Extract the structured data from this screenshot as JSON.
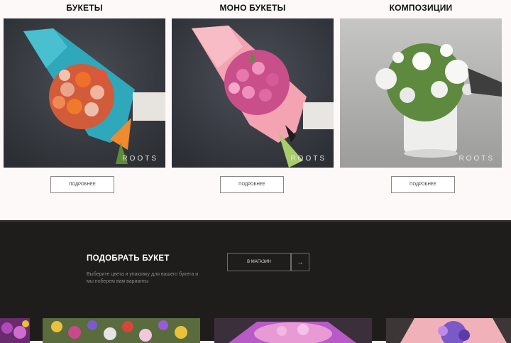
{
  "categories": [
    {
      "title": "БУКЕТЫ",
      "button_label": "ПОДРОБНЕЕ",
      "watermark": "ROOTS"
    },
    {
      "title": "МОНО БУКЕТЫ",
      "button_label": "ПОДРОБНЕЕ",
      "watermark": "ROOTS"
    },
    {
      "title": "КОМПОЗИЦИИ",
      "button_label": "ПОДРОБНЕЕ",
      "watermark": "ROOTS"
    }
  ],
  "picker": {
    "title": "ПОДОБРАТЬ БУКЕТ",
    "description": "Выберите цвета и упаковку для вашего букета и мы поберем вам варианты",
    "shop_button": "В МАГАЗИН",
    "arrow": "→"
  },
  "colors": {
    "accent_dark": "#1e1d1b",
    "card_bg": "#fdf9f9",
    "wrap_teal": "#2aa5b8",
    "wrap_pink": "#f3a3b2"
  }
}
